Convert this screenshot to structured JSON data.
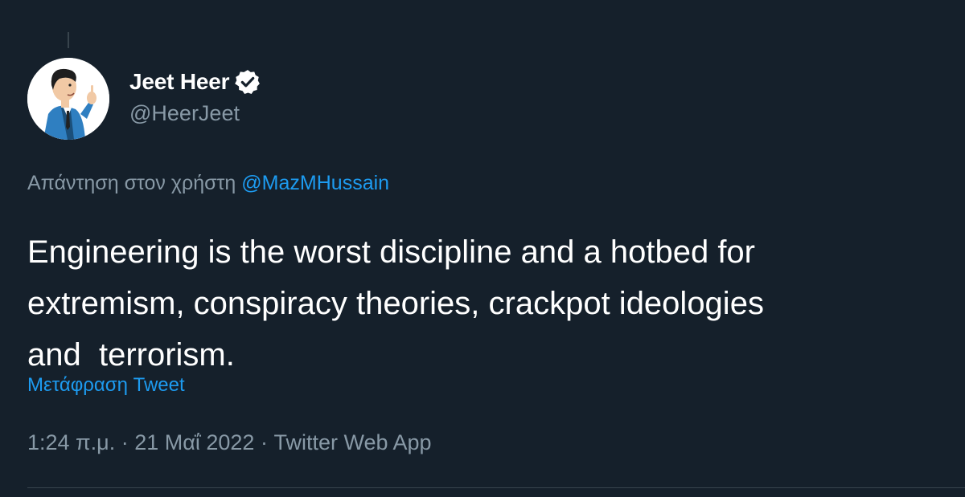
{
  "author": {
    "display_name": "Jeet Heer",
    "handle": "@HeerJeet",
    "verified_icon": "verified-badge-icon"
  },
  "reply": {
    "prefix": "Απάντηση στον χρήστη ",
    "mention": "@MazMHussain"
  },
  "tweet": {
    "text": "Engineering is the worst discipline and a hotbed for\nextremism, conspiracy theories, crackpot ideologies\nand  terrorism.",
    "translate_label": "Μετάφραση Tweet"
  },
  "meta": {
    "time": "1:24 π.μ.",
    "separator": " · ",
    "date": "21 Μαΐ 2022",
    "source": "Twitter Web App"
  },
  "colors": {
    "background": "#15202b",
    "primary_text": "#ffffff",
    "secondary_text": "#8899a6",
    "link": "#1d9bf0",
    "divider": "#38444d"
  }
}
